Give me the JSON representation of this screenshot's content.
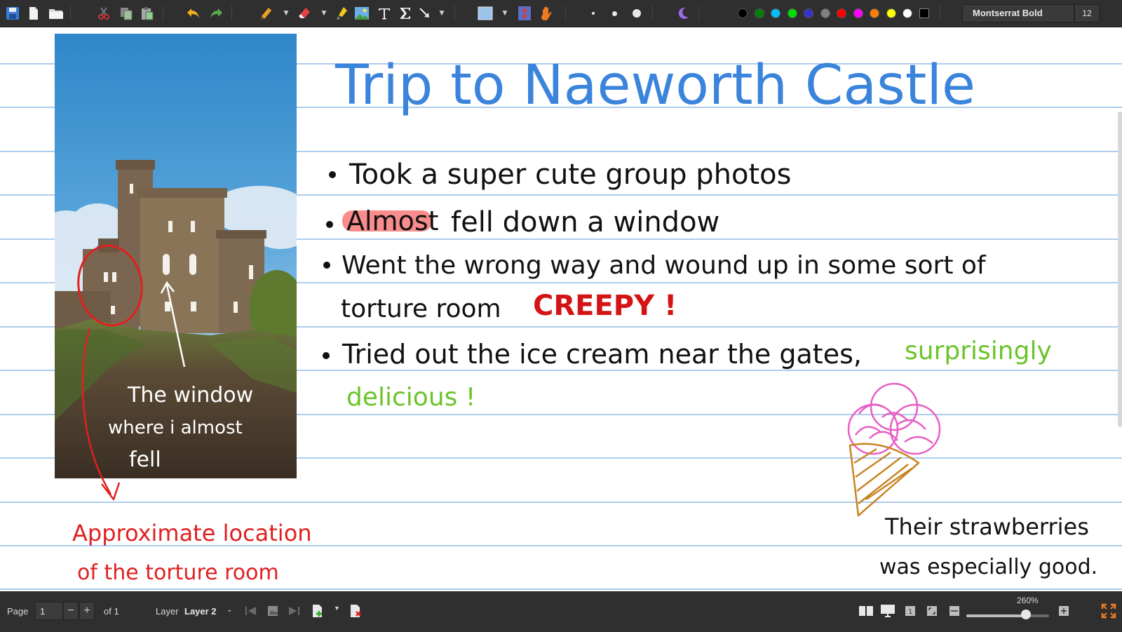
{
  "toolbar": {
    "tools": [
      "save",
      "new-document",
      "open-folder",
      "cut",
      "copy",
      "paste",
      "undo",
      "redo",
      "pen",
      "eraser",
      "highlighter",
      "image",
      "text",
      "formula",
      "arrow",
      "select-rect",
      "vertical-space",
      "hand"
    ],
    "pen_sizes": [
      "fine",
      "medium",
      "thick"
    ],
    "colors": [
      "#000000",
      "#008000",
      "#00c0ff",
      "#00e000",
      "#3333cc",
      "#808080",
      "#ff0000",
      "#ff00ff",
      "#ff8000",
      "#ffff00",
      "#ffffff",
      "#000000"
    ],
    "active_color": "#000000",
    "font_name": "Montserrat Bold",
    "font_size": "12"
  },
  "note": {
    "title": "Trip to  Naeworth Castle",
    "bullet_1": "Took a  super cute group photos",
    "bullet_2_highlight": "Almost",
    "bullet_2_rest": "fell down a window",
    "bullet_3_line1": "Went  the  wrong  way  and  wound  up  in  some  sort  of",
    "bullet_3_line2": "torture  room",
    "bullet_3_emph": "CREEPY !",
    "bullet_4_line1": "Tried out  the ice cream  near the gates,",
    "bullet_4_green1": "surprisingly",
    "bullet_4_green2": "delicious !",
    "photo_caption_line1": "The window",
    "photo_caption_line2": "where i almost",
    "photo_caption_line3": "fell",
    "red_note_line1": "Approximate location",
    "red_note_line2": "of the torture room",
    "icecream_note_line1": "Their strawberries",
    "icecream_note_line2": "was especially good."
  },
  "statusbar": {
    "page_label": "Page",
    "page_value": "1",
    "page_total": "of 1",
    "layer_label": "Layer",
    "layer_value": "Layer 2",
    "zoom_label": "260%",
    "zoom_fraction": 0.72
  }
}
